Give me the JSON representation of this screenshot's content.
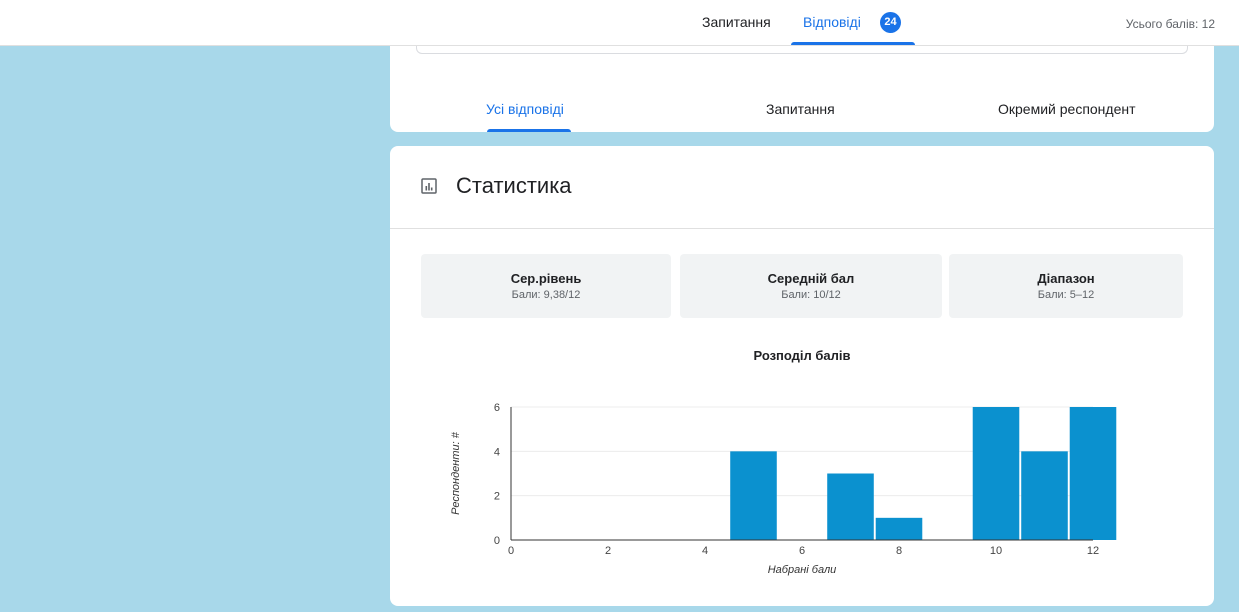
{
  "topbar": {
    "tab_questions": "Запитання",
    "tab_responses": "Відповіді",
    "responses_count": "24",
    "total_points": "Усього балів: 12"
  },
  "subtabs": {
    "summary": "Усі відповіді",
    "question": "Запитання",
    "individual": "Окремий респондент"
  },
  "stats": {
    "title": "Статистика",
    "average": {
      "label": "Сер.рівень",
      "value": "Бали: 9,38/12"
    },
    "median": {
      "label": "Середній бал",
      "value": "Бали: 10/12"
    },
    "range": {
      "label": "Діапазон",
      "value": "Бали: 5–12"
    }
  },
  "colors": {
    "accent": "#1a73e8",
    "bar": "#0b91cf",
    "background": "#a8d8ea"
  },
  "chart_data": {
    "type": "bar",
    "title": "Розподіл балів",
    "xlabel": "Набрані бали",
    "ylabel": "Респонденти: #",
    "xlim": [
      0,
      12
    ],
    "ylim": [
      0,
      6
    ],
    "xticks": [
      "0",
      "2",
      "4",
      "6",
      "8",
      "10",
      "12"
    ],
    "yticks": [
      "0",
      "2",
      "4",
      "6"
    ],
    "grid": true,
    "x": [
      5,
      7,
      8,
      10,
      11,
      12
    ],
    "values": [
      4,
      3,
      1,
      6,
      4,
      6
    ]
  }
}
